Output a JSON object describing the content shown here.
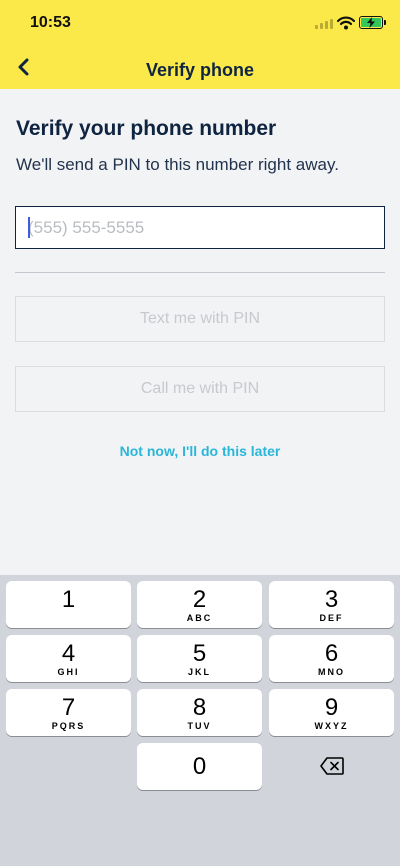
{
  "status_bar": {
    "time": "10:53"
  },
  "nav": {
    "title": "Verify phone"
  },
  "main": {
    "heading": "Verify your phone number",
    "subtext": "We'll send a PIN to this number right away.",
    "phone_placeholder": "(555) 555-5555",
    "text_button": "Text me with PIN",
    "call_button": "Call me with PIN",
    "later_link": "Not now, I'll do this later"
  },
  "keyboard": {
    "keys": [
      {
        "number": "1",
        "letters": ""
      },
      {
        "number": "2",
        "letters": "ABC"
      },
      {
        "number": "3",
        "letters": "DEF"
      },
      {
        "number": "4",
        "letters": "GHI"
      },
      {
        "number": "5",
        "letters": "JKL"
      },
      {
        "number": "6",
        "letters": "MNO"
      },
      {
        "number": "7",
        "letters": "PQRS"
      },
      {
        "number": "8",
        "letters": "TUV"
      },
      {
        "number": "9",
        "letters": "WXYZ"
      },
      {
        "number": "0",
        "letters": ""
      }
    ]
  },
  "colors": {
    "brand_yellow": "#fbe94a",
    "navy": "#0f2441",
    "link_cyan": "#29b6d8"
  }
}
